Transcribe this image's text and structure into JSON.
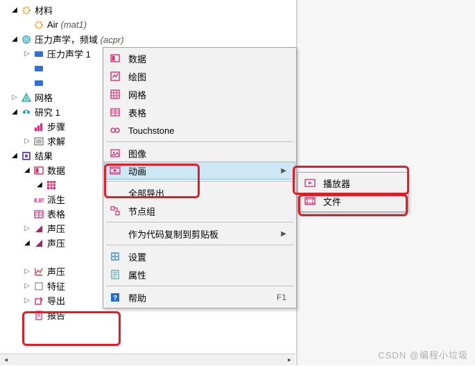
{
  "colors": {
    "pink": "#d82e73",
    "blue": "#2e6fd8",
    "aqua": "#18a4c8",
    "orange": "#f59a23",
    "teal": "#2ab0a0",
    "purple": "#6e4fbf"
  },
  "tree": {
    "materials": {
      "label": "材料",
      "child_label": "Air",
      "child_tag": "(mat1)"
    },
    "physics": {
      "label": "压力声学，频域",
      "tag": "(acpr)",
      "child": "压力声学 1"
    },
    "dummy1": "",
    "dummy2": "",
    "mesh": "网格",
    "study": {
      "label": "研究 1",
      "child1": "步骤",
      "child2": "求解"
    },
    "results": {
      "label": "结果",
      "datasets": "数据",
      "dataset_child": "",
      "derived": "派生",
      "tables": "表格",
      "plot2d_a": "声压",
      "plot2d_b": "声压",
      "plot2d_c": "声压",
      "eval": "特征",
      "export": "导出",
      "reports": "报告"
    }
  },
  "menu": {
    "data": "数据",
    "plots": "绘图",
    "mesh": "网格",
    "tables": "表格",
    "touchstone": "Touchstone",
    "image": "图像",
    "anim": "动画",
    "export_all": "全部导出",
    "node_group": "节点组",
    "copy_code": "作为代码复制到剪贴板",
    "settings": "设置",
    "props": "属性",
    "help": "帮助",
    "help_key": "F1"
  },
  "submenu": {
    "player": "播放器",
    "file": "文件"
  },
  "watermark": "CSDN @编程小垃圾"
}
